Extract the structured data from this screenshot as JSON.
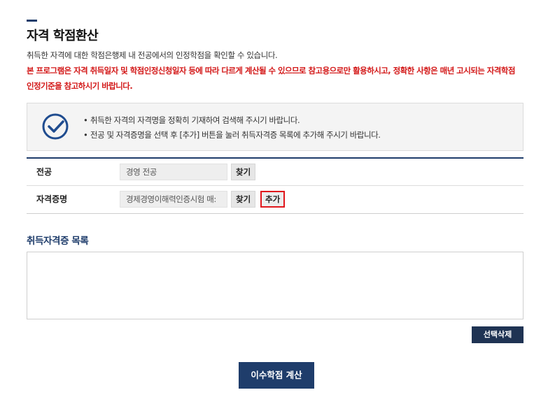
{
  "page": {
    "title": "자격 학점환산",
    "description": "취득한 자격에 대한 학점은행제 내 전공에서의 인정학점을 확인할 수 있습니다.",
    "warning": "본 프로그램은 자격 취득일자 및 학점인정신청일자 등에 따라 다르게 계산될 수 있으므로 참고용으로만 활용하시고, 정확한 사항은 매년 고시되는 자격학점인정기준을 참고하시기 바랍니다.",
    "accent_color": "#1f3d6b",
    "warning_color": "#d31818"
  },
  "notice": {
    "icon": "check-circle-icon",
    "items": [
      "취득한 자격의 자격명을 정확히 기재하여 검색해 주시기 바랍니다.",
      "전공 및 자격증명을 선택 후 [추가] 버튼을 눌러 취득자격증 목록에 추가해 주시기 바랍니다."
    ]
  },
  "form": {
    "major": {
      "label": "전공",
      "value": "경영 전공",
      "find_label": "찾기"
    },
    "certificate": {
      "label": "자격증명",
      "value": "경제경영이해력인증시험 매:",
      "find_label": "찾기",
      "add_label": "추가"
    }
  },
  "list": {
    "title": "취득자격증 목록",
    "items": [],
    "delete_label": "선택삭제"
  },
  "calculate_label": "이수학점 계산"
}
